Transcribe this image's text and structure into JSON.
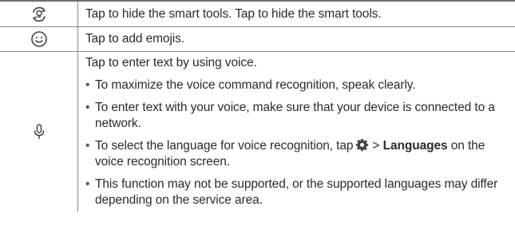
{
  "rows": [
    {
      "icon": "smart-tools-refresh-icon",
      "text": "Tap to hide the smart tools. Tap to hide the smart tools."
    },
    {
      "icon": "smiley-face-icon",
      "text": "Tap to add emojis."
    },
    {
      "icon": "microphone-icon",
      "intro": "Tap to enter text by using voice.",
      "bullets": [
        "To maximize the voice command recognition, speak clearly.",
        "To enter text with your voice, make sure that your device is connected to a network."
      ],
      "bullet3": {
        "before": "To select the language for voice recognition, tap",
        "gear_icon": "gear-icon",
        "arrow": ">",
        "bold": "Languages",
        "after": "on the voice recognition screen."
      },
      "bullet4": "This function may not be supported, or the supported languages may differ depending on the service area.",
      "bullet_marker": "•"
    }
  ],
  "colors": {
    "text": "#2b2b2b",
    "border": "#8a8a8a",
    "icon": "#444444"
  }
}
